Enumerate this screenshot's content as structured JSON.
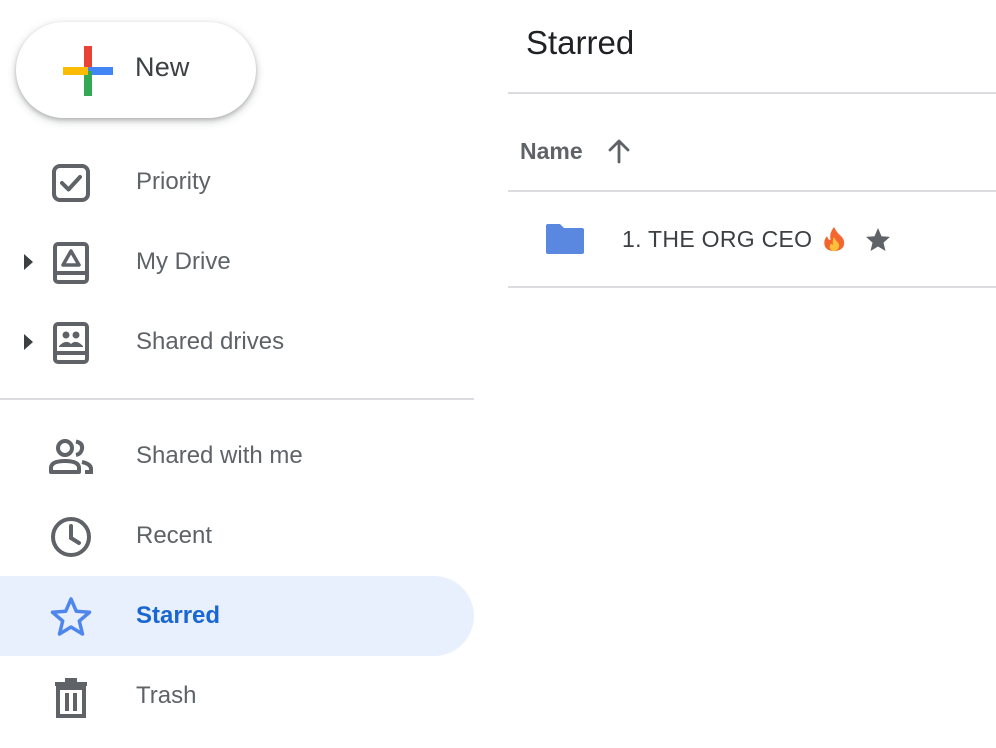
{
  "sidebar": {
    "new_button": {
      "label": "New"
    },
    "items": [
      {
        "label": "Priority",
        "icon": "priority-check-icon"
      },
      {
        "label": "My Drive",
        "icon": "my-drive-icon",
        "expandable": true
      },
      {
        "label": "Shared drives",
        "icon": "shared-drives-icon",
        "expandable": true
      },
      {
        "label": "Shared with me",
        "icon": "people-icon"
      },
      {
        "label": "Recent",
        "icon": "clock-icon"
      },
      {
        "label": "Starred",
        "icon": "star-outline-icon",
        "active": true
      },
      {
        "label": "Trash",
        "icon": "trash-icon"
      }
    ]
  },
  "main": {
    "title": "Starred",
    "columns": [
      {
        "label": "Name",
        "sort": "ascending"
      }
    ],
    "files": [
      {
        "name": "1. THE ORG CEO",
        "type": "folder",
        "emoji": "fire-icon",
        "starred": true
      }
    ]
  },
  "colors": {
    "accent": "#1967d2",
    "active_bg": "#e8f0fe",
    "folder": "#5a87e0",
    "text_secondary": "#5f6368",
    "divider": "#dadce0"
  }
}
